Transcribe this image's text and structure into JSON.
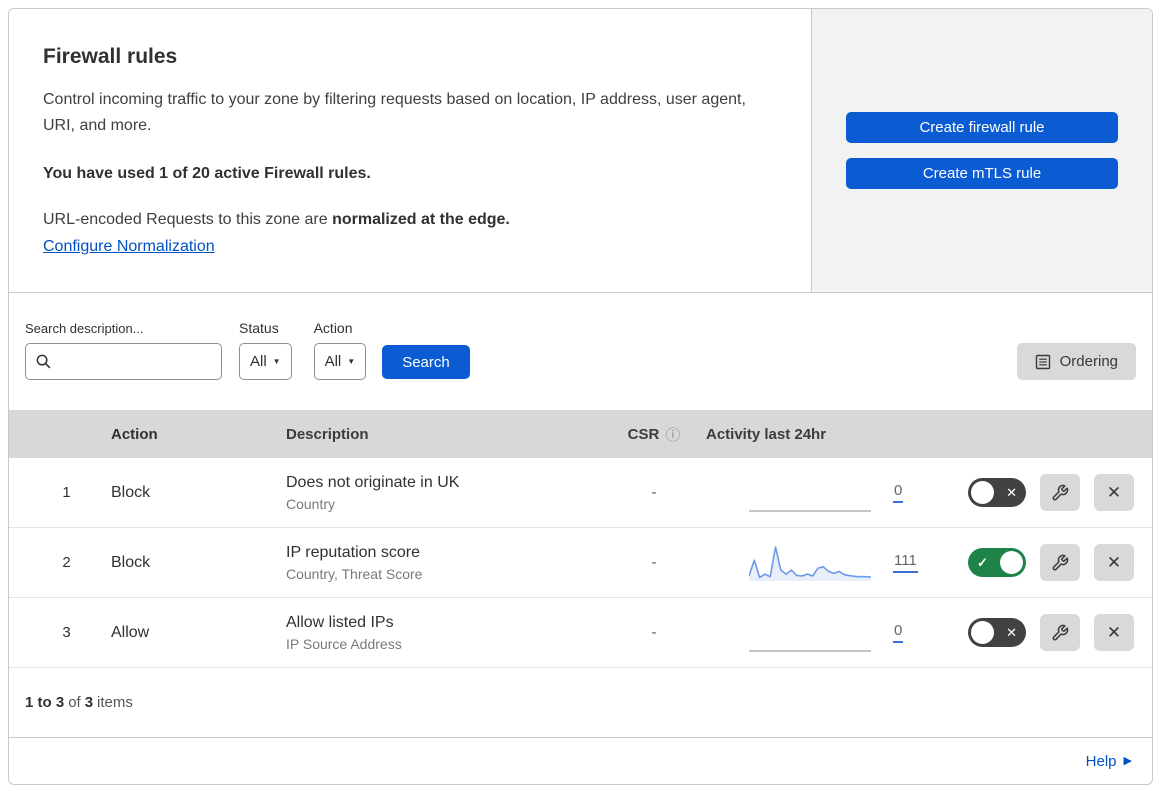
{
  "header": {
    "title": "Firewall rules",
    "description": "Control incoming traffic to your zone by filtering requests based on location, IP address, user agent, URI, and more.",
    "usage_bold": "You have used 1 of 20 active Firewall rules.",
    "normalization_prefix": "URL-encoded Requests to this zone are ",
    "normalization_bold": "normalized at the edge.",
    "configure_link": "Configure Normalization",
    "buttons": [
      {
        "label": "Create firewall rule"
      },
      {
        "label": "Create mTLS rule"
      }
    ]
  },
  "filters": {
    "search_label": "Search description...",
    "search_value": "",
    "status_label": "Status",
    "status_value": "All",
    "action_label": "Action",
    "action_value": "All",
    "search_button": "Search",
    "ordering_button": "Ordering"
  },
  "table": {
    "columns": {
      "action": "Action",
      "description": "Description",
      "csr": "CSR",
      "activity": "Activity last 24hr"
    },
    "rows": [
      {
        "num": "1",
        "action": "Block",
        "description": "Does not originate in UK",
        "fields": "Country",
        "csr": "-",
        "activity_count": "0",
        "enabled": false,
        "sparkline": []
      },
      {
        "num": "2",
        "action": "Block",
        "description": "IP reputation score",
        "fields": "Country, Threat Score",
        "csr": "-",
        "activity_count": "111",
        "enabled": true,
        "sparkline": [
          12,
          60,
          8,
          18,
          10,
          100,
          30,
          18,
          30,
          14,
          12,
          18,
          12,
          36,
          40,
          26,
          20,
          26,
          16,
          13,
          11,
          10,
          10,
          9
        ]
      },
      {
        "num": "3",
        "action": "Allow",
        "description": "Allow listed IPs",
        "fields": "IP Source Address",
        "csr": "-",
        "activity_count": "0",
        "enabled": false,
        "sparkline": []
      }
    ]
  },
  "footer": {
    "range": "1 to 3",
    "of_label": "of",
    "total": "3",
    "items_label": "items",
    "help_label": "Help"
  },
  "colors": {
    "accent": "#0b5bd3",
    "link": "#0051c3",
    "toggle_on": "#1e8348",
    "toggle_off": "#424242",
    "spark": "#6d9ae8"
  }
}
